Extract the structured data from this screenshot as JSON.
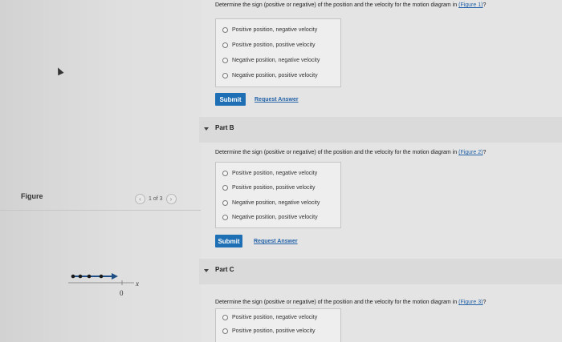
{
  "figure": {
    "label": "Figure",
    "pager": "1 of 3",
    "prev_glyph": "‹",
    "next_glyph": "›",
    "diagram": {
      "axis_label": "x",
      "origin_label": "0"
    }
  },
  "part_a": {
    "question_prefix": "Determine the sign (positive or negative) of the position and the velocity for the motion diagram in ",
    "figure_link": "(Figure 1)",
    "question_suffix": "?",
    "options": [
      "Positive position, negative velocity",
      "Positive position, positive velocity",
      "Negative position, negative velocity",
      "Negative position, positive velocity"
    ],
    "submit": "Submit",
    "request": "Request Answer"
  },
  "part_b": {
    "title": "Part B",
    "question_prefix": "Determine the sign (positive or negative) of the position and the velocity for the motion diagram in ",
    "figure_link": "(Figure 2)",
    "question_suffix": "?",
    "options": [
      "Positive position, negative velocity",
      "Positive position, positive velocity",
      "Negative position, negative velocity",
      "Negative position, positive velocity"
    ],
    "submit": "Submit",
    "request": "Request Answer"
  },
  "part_c": {
    "title": "Part C",
    "question_prefix": "Determine the sign (positive or negative) of the position and the velocity for the motion diagram in ",
    "figure_link": "(Figure 3)",
    "question_suffix": "?",
    "options": [
      "Positive position, negative velocity",
      "Positive position, positive velocity"
    ]
  }
}
